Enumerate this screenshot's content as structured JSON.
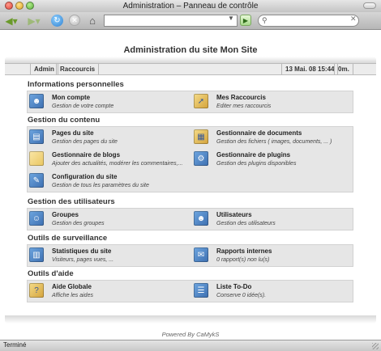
{
  "window": {
    "title": "Administration – Panneau de contrôle"
  },
  "browser": {
    "url": "",
    "search": ""
  },
  "page": {
    "title": "Administration du site Mon Site"
  },
  "menubar": {
    "admin": "Admin",
    "shortcuts": "Raccourcis",
    "date": "13 Mai. 08 15:44",
    "users_count": "0m."
  },
  "sections": [
    {
      "title": "Informations personnelles",
      "cards": [
        {
          "title": "Mon compte",
          "desc": "Gestion de votre compte",
          "icon": "account-icon"
        },
        {
          "title": "Mes Raccourcis",
          "desc": "Editer mes raccourcis",
          "icon": "shortcuts-icon"
        }
      ]
    },
    {
      "title": "Gestion du contenu",
      "cards": [
        {
          "title": "Pages du site",
          "desc": "Gestion des pages du site",
          "icon": "pages-icon"
        },
        {
          "title": "Gestionnaire de documents",
          "desc": "Gestion des fichiers ( images, documents, ... )",
          "icon": "documents-icon"
        },
        {
          "title": "Gestionnaire de blogs",
          "desc": "Ajouter des actualités, modérer les commentaires,...",
          "icon": "blog-icon"
        },
        {
          "title": "Gestionnaire de plugins",
          "desc": "Gestion des plugins disponibles",
          "icon": "plugins-icon"
        },
        {
          "title": "Configuration du site",
          "desc": "Gestion de tous les paramètres du site",
          "icon": "config-icon"
        }
      ]
    },
    {
      "title": "Gestion des utilisateurs",
      "cards": [
        {
          "title": "Groupes",
          "desc": "Gestion des groupes",
          "icon": "groups-icon"
        },
        {
          "title": "Utilisateurs",
          "desc": "Gestion des utilisateurs",
          "icon": "users-icon"
        }
      ]
    },
    {
      "title": "Outils de surveillance",
      "cards": [
        {
          "title": "Statistiques du site",
          "desc": "Visiteurs, pages vues, ...",
          "icon": "stats-icon"
        },
        {
          "title": "Rapports internes",
          "desc": "0 rapport(s) non lu(s)",
          "icon": "reports-icon"
        }
      ]
    },
    {
      "title": "Outils d'aide",
      "cards": [
        {
          "title": "Aide Globale",
          "desc": "Affiche les aides",
          "icon": "help-icon"
        },
        {
          "title": "Liste To-Do",
          "desc": "Conserve 0 idée(s).",
          "icon": "todo-icon"
        }
      ]
    }
  ],
  "footer": {
    "powered": "Powered By CaMykS"
  },
  "status": {
    "text": "Terminé"
  },
  "colors": {
    "row_bg": "#e6e6e6",
    "icon_blue": "#4a86c8",
    "icon_yellow": "#f2d07a"
  }
}
